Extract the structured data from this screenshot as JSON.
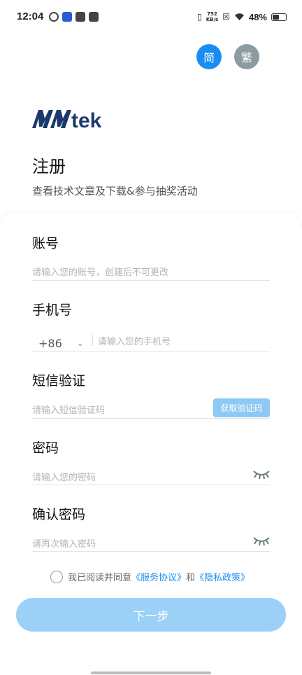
{
  "status_bar": {
    "time": "12:04",
    "net_speed_value": "752",
    "net_speed_unit": "KB/s",
    "battery": "48%",
    "battery_level": 0.48
  },
  "header": {
    "lang_simplified": "简",
    "lang_traditional": "繁",
    "logo_text": "MAtek",
    "title": "注册",
    "subtitle": "查看技术文章及下载&参与抽奖活动"
  },
  "form": {
    "account": {
      "label": "账号",
      "placeholder": "请输入您的账号，创建后不可更改"
    },
    "phone": {
      "label": "手机号",
      "country_code": "+86",
      "placeholder": "请输入您的手机号"
    },
    "sms": {
      "label": "短信验证",
      "placeholder": "请输入短信验证码",
      "button": "获取验证码"
    },
    "password": {
      "label": "密码",
      "placeholder": "请输入您的密码"
    },
    "confirm_password": {
      "label": "确认密码",
      "placeholder": "请再次输入密码"
    },
    "agreement": {
      "prefix": "我已阅读并同意",
      "service_link": "《服务协议》",
      "and": "和",
      "privacy_link": "《隐私政策》"
    },
    "next_button": "下一步"
  },
  "colors": {
    "primary": "#1a8ef0",
    "button_disabled": "#9bd0f7",
    "logo": "#1b3a6b",
    "gray_lang": "#8c9aa1"
  },
  "icons": {
    "eye": "closed-eye-icon",
    "dropdown": "chevron-down-icon"
  }
}
